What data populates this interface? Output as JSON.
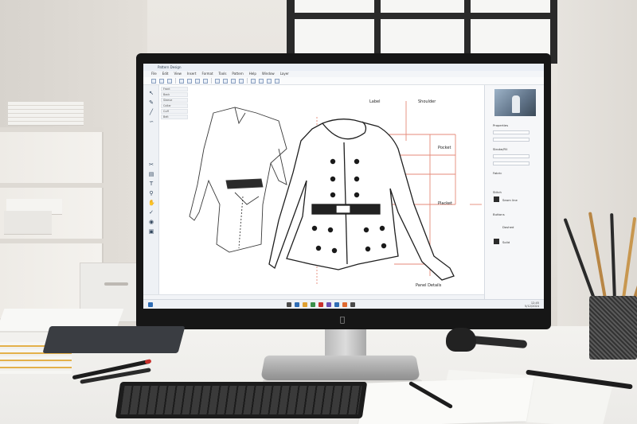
{
  "app": {
    "title": "Pattern Design",
    "menus": [
      "File",
      "Edit",
      "View",
      "Insert",
      "Format",
      "Tools",
      "Pattern",
      "Help",
      "Window",
      "Layer"
    ],
    "layers": [
      "Front",
      "Back",
      "Sleeve",
      "Collar",
      "Cuff",
      "Belt"
    ]
  },
  "drawing": {
    "annotations": [
      {
        "id": "label",
        "text": "Label"
      },
      {
        "id": "shoulder",
        "text": "Shoulder"
      },
      {
        "id": "pocket",
        "text": "Pocket"
      },
      {
        "id": "placket",
        "text": "Placket"
      },
      {
        "id": "panel",
        "text": "Panel Details"
      }
    ]
  },
  "properties_panel": {
    "sections": [
      "Properties",
      "Stroke/Fill",
      "Fabric",
      "Stitch",
      "Buttons"
    ],
    "items": [
      "Seam line",
      "Dashed",
      "Solid"
    ]
  },
  "colors": {
    "measure_line": "#e58a78",
    "stroke": "#1f1f1f",
    "accent": "#2f6db5"
  },
  "taskbar": {
    "time": "12:45",
    "date": "5/12/2024"
  },
  "icons": [
    "select-icon",
    "pen-icon",
    "line-icon",
    "curve-icon",
    "scissors-icon",
    "ruler-icon",
    "text-icon",
    "zoom-icon"
  ]
}
